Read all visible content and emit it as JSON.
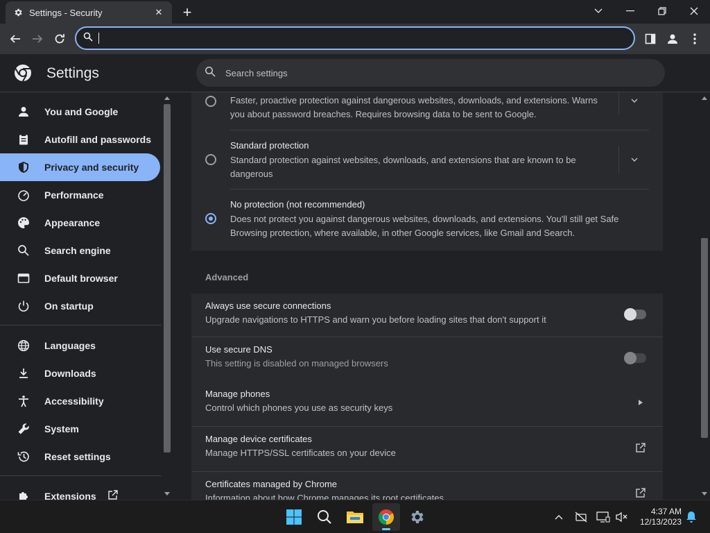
{
  "window": {
    "tab_title": "Settings - Security",
    "tab_icon": "gear-icon",
    "close_tab_glyph": "✕",
    "new_tab_glyph": "+",
    "controls": [
      "chevron-down-icon",
      "minimize-icon",
      "restore-icon",
      "close-icon"
    ]
  },
  "toolbar": {
    "omnibox_value": "",
    "buttons": [
      "back-icon",
      "forward-icon",
      "reload-icon",
      "side-panel-icon",
      "profile-icon",
      "more-icon"
    ]
  },
  "header": {
    "title": "Settings",
    "search_placeholder": "Search settings"
  },
  "sidebar": {
    "items": [
      {
        "label": "You and Google",
        "icon": "person-icon"
      },
      {
        "label": "Autofill and passwords",
        "icon": "clipboard-icon"
      },
      {
        "label": "Privacy and security",
        "icon": "shield-icon",
        "active": true
      },
      {
        "label": "Performance",
        "icon": "speedometer-icon"
      },
      {
        "label": "Appearance",
        "icon": "palette-icon"
      },
      {
        "label": "Search engine",
        "icon": "search-icon"
      },
      {
        "label": "Default browser",
        "icon": "browser-icon"
      },
      {
        "label": "On startup",
        "icon": "power-icon"
      },
      {
        "label": "Languages",
        "icon": "globe-icon"
      },
      {
        "label": "Downloads",
        "icon": "download-icon"
      },
      {
        "label": "Accessibility",
        "icon": "accessibility-icon"
      },
      {
        "label": "System",
        "icon": "wrench-icon"
      },
      {
        "label": "Reset settings",
        "icon": "history-icon"
      },
      {
        "label": "Extensions",
        "icon": "puzzle-icon"
      }
    ]
  },
  "safe_browsing": {
    "options": [
      {
        "title": "",
        "description_line1": "Faster, proactive protection against dangerous websites, downloads, and extensions. Warns",
        "description_line2": "you about password breaches. Requires browsing data to be sent to Google.",
        "selected": false
      },
      {
        "title": "Standard protection",
        "description_line1": "Standard protection against websites, downloads, and extensions that are known to be",
        "description_line2": "dangerous",
        "selected": false
      },
      {
        "title": "No protection (not recommended)",
        "description_line1": "Does not protect you against dangerous websites, downloads, and extensions. You'll still get Safe",
        "description_line2": "Browsing protection, where available, in other Google services, like Gmail and Search.",
        "selected": true
      }
    ]
  },
  "advanced": {
    "heading": "Advanced",
    "rows": [
      {
        "title": "Always use secure connections",
        "description": "Upgrade navigations to HTTPS and warn you before loading sites that don't support it",
        "control": "toggle",
        "toggle_on": false
      },
      {
        "title": "Use secure DNS",
        "description": "This setting is disabled on managed browsers",
        "control": "toggle",
        "toggle_on": false,
        "disabled": true
      },
      {
        "title": "Manage phones",
        "description": "Control which phones you use as security keys",
        "control": "arrow"
      },
      {
        "title": "Manage device certificates",
        "description": "Manage HTTPS/SSL certificates on your device",
        "control": "external"
      },
      {
        "title": "Certificates managed by Chrome",
        "description": "Information about how Chrome manages its root certificates",
        "control": "external"
      }
    ]
  },
  "taskbar": {
    "apps": [
      "windows-start-icon",
      "search-icon",
      "file-explorer-icon",
      "chrome-icon",
      "settings-icon"
    ],
    "tray": [
      "chevron-up-icon",
      "network-off-icon",
      "display-icon",
      "mute-icon",
      "notification-bell-icon"
    ],
    "time": "4:37 AM",
    "date": "12/13/2023"
  },
  "colors": {
    "accent": "#8ab4f8",
    "background": "#202124",
    "card": "#292a2d"
  }
}
